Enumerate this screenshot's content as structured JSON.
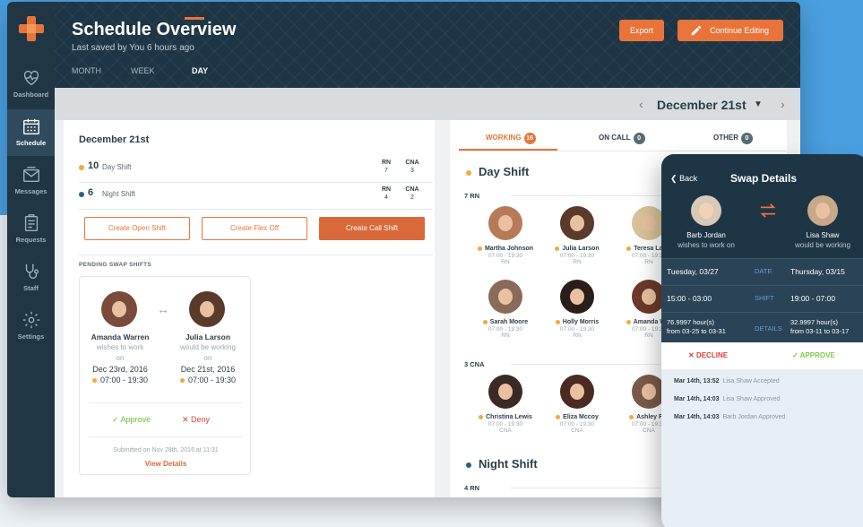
{
  "colors": {
    "accent": "#e8743b",
    "sidebar": "#213645",
    "header": "#1e3545",
    "day_dot": "#f2a93b",
    "night_dot": "#2a5d8a",
    "approve": "#6cbf3a",
    "deny": "#d8433a"
  },
  "sidebar": {
    "items": [
      {
        "label": "Dashboard",
        "icon": "heart-monitor-icon"
      },
      {
        "label": "Schedule",
        "icon": "calendar-icon"
      },
      {
        "label": "Messages",
        "icon": "envelope-icon"
      },
      {
        "label": "Requests",
        "icon": "clipboard-icon"
      },
      {
        "label": "Staff",
        "icon": "stethoscope-icon"
      },
      {
        "label": "Settings",
        "icon": "gear-icon"
      }
    ]
  },
  "header": {
    "title": "Schedule Overview",
    "subtitle": "Last saved by You 6 hours ago",
    "tabs": [
      {
        "label": "MONTH"
      },
      {
        "label": "WEEK"
      },
      {
        "label": "DAY"
      }
    ],
    "export_label": "Export",
    "continue_label": "Continue Editing"
  },
  "datebar": {
    "date": "December 21st"
  },
  "left": {
    "title": "December 21st",
    "shifts": [
      {
        "count": "10",
        "name": "Day Shift",
        "rn_label": "RN",
        "rn": "7",
        "cna_label": "CNA",
        "cna": "3"
      },
      {
        "count": "6",
        "name": "Night Shift",
        "rn_label": "RN",
        "rn": "4",
        "cna_label": "CNA",
        "cna": "2"
      }
    ],
    "buttons": {
      "open": "Create Open Shift",
      "flex": "Create Flex Off",
      "call": "Create Call Shift"
    },
    "pending_label": "PENDING SWAP SHIFTS",
    "swap": {
      "from_name": "Amanda Warren",
      "from_sub1": "wishes to work",
      "from_sub2": "on",
      "from_date": "Dec 23rd, 2016",
      "from_time": "07:00 - 19:30",
      "to_name": "Julia Larson",
      "to_sub1": "would be working",
      "to_sub2": "on",
      "to_date": "Dec 21st, 2016",
      "to_time": "07:00 - 19:30",
      "approve": "Approve",
      "deny": "Deny",
      "submitted": "Submitted on Nov 28th, 2016 at 11:31",
      "details": "View Details"
    }
  },
  "right": {
    "tabs": [
      {
        "label": "WORKING",
        "count": "16"
      },
      {
        "label": "ON CALL",
        "count": "0"
      },
      {
        "label": "OTHER",
        "count": "0"
      }
    ],
    "day_title": "Day Shift",
    "night_title": "Night Shift",
    "rn_group": "7 RN",
    "cna_group": "3 CNA",
    "night_rn_group": "4 RN",
    "rn_people": [
      {
        "name": "Martha Johnson",
        "time": "07:00 - 19:30",
        "role": "RN"
      },
      {
        "name": "Julia Larson",
        "time": "07:00 - 19:30",
        "role": "RN"
      },
      {
        "name": "Teresa Laws",
        "time": "07:00 - 19:30",
        "role": "RN"
      },
      {
        "name": "Sarah Moore",
        "time": "07:00 - 19:30",
        "role": "RN"
      },
      {
        "name": "Holly Morris",
        "time": "07:00 - 19:30",
        "role": "RN"
      },
      {
        "name": "Amanda War",
        "time": "07:00 - 19:30",
        "role": "RN"
      }
    ],
    "cna_people": [
      {
        "name": "Christina Lewis",
        "time": "07:00 - 19:30",
        "role": "CNA"
      },
      {
        "name": "Eliza Mccoy",
        "time": "07:00 - 19:30",
        "role": "CNA"
      },
      {
        "name": "Ashley Ric",
        "time": "07:00 - 19:30",
        "role": "CNA"
      }
    ]
  },
  "phone": {
    "back": "Back",
    "title": "Swap Details",
    "from_name": "Barb Jordan",
    "from_sub": "wishes to work on",
    "to_name": "Lisa Shaw",
    "to_sub": "would be working",
    "rows": [
      {
        "left": "Tuesday, 03/27",
        "mid": "DATE",
        "right": "Thursday, 03/15"
      },
      {
        "left": "15:00 - 03:00",
        "mid": "SHIFT",
        "right": "19:00 - 07:00"
      }
    ],
    "details": {
      "left1": "76.9997 hour(s)",
      "left2": "from 03-25 to 03-31",
      "mid": "DETAILS",
      "right1": "32.9997 hour(s)",
      "right2": "from 03-11 to 03-17"
    },
    "decline": "DECLINE",
    "approve": "APPROVE",
    "log": [
      {
        "time": "Mar 14th, 13:52",
        "text": "Lisa Shaw Accepted"
      },
      {
        "time": "Mar 14th, 14:03",
        "text": "Lisa Shaw Approved"
      },
      {
        "time": "Mar 14th, 14:03",
        "text": "Barb Jordan Approved"
      }
    ]
  }
}
